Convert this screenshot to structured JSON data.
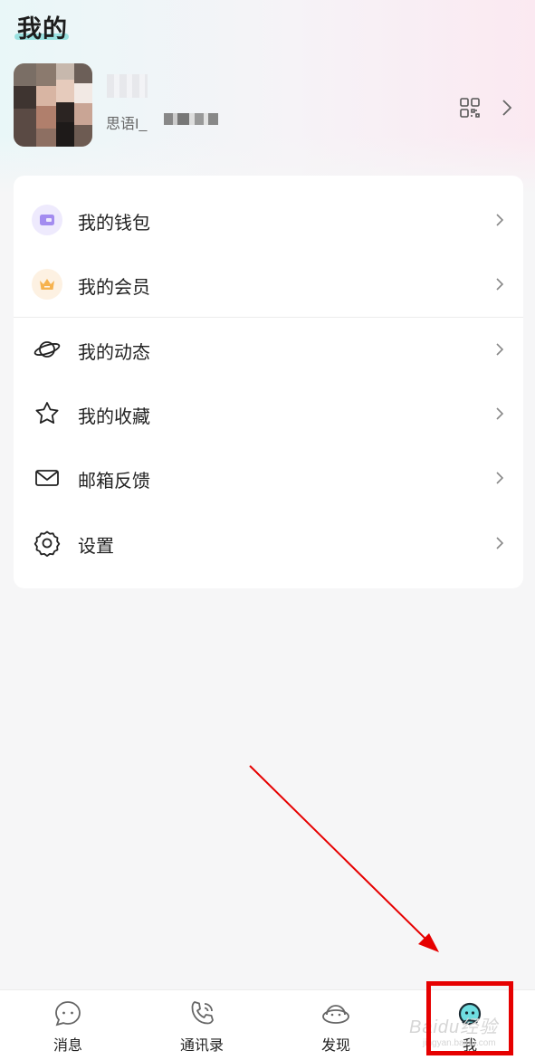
{
  "header": {
    "title": "我的",
    "user": {
      "id_prefix": "思语I_"
    }
  },
  "menu": {
    "items": [
      {
        "label": "我的钱包",
        "icon": "wallet-icon"
      },
      {
        "label": "我的会员",
        "icon": "crown-icon"
      },
      {
        "label": "我的动态",
        "icon": "planet-icon"
      },
      {
        "label": "我的收藏",
        "icon": "star-icon"
      },
      {
        "label": "邮箱反馈",
        "icon": "mail-icon"
      },
      {
        "label": "设置",
        "icon": "gear-icon"
      }
    ]
  },
  "tabbar": {
    "tabs": [
      {
        "label": "消息",
        "icon": "chat-bubble-icon"
      },
      {
        "label": "通讯录",
        "icon": "phone-icon"
      },
      {
        "label": "发现",
        "icon": "planet-face-icon"
      },
      {
        "label": "我",
        "icon": "profile-face-icon",
        "active": true
      }
    ]
  },
  "watermark": {
    "text": "Baidu经验",
    "sub": "jingyan.baidu.com"
  },
  "colors": {
    "annotation": "#e60000",
    "accent": "#7fd9d8",
    "wallet_bg": "#eeeafd",
    "crown_bg": "#fdf1e2"
  }
}
